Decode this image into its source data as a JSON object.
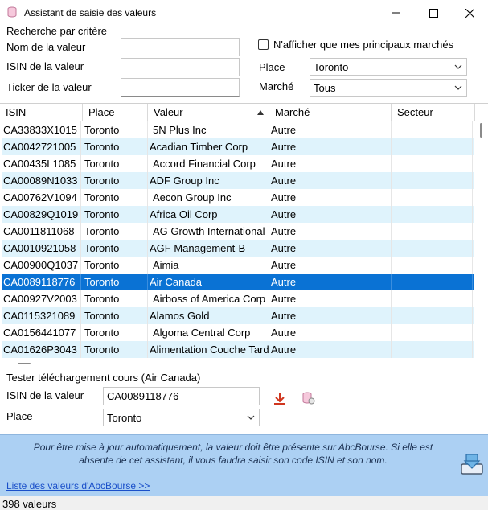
{
  "window": {
    "title": "Assistant de saisie des valeurs"
  },
  "search": {
    "group_title": "Recherche par critère",
    "name_label": "Nom de la valeur",
    "name_value": "",
    "isin_label": "ISIN de la valeur",
    "isin_value": "",
    "ticker_label": "Ticker de la valeur",
    "ticker_value": "",
    "main_markets_checkbox_label": "N'afficher que mes principaux marchés",
    "main_markets_checked": false,
    "place_label": "Place",
    "place_value": "Toronto",
    "market_label": "Marché",
    "market_value": "Tous"
  },
  "grid": {
    "columns": [
      "ISIN",
      "Place",
      "Valeur",
      "Marché",
      "Secteur"
    ],
    "sort_column": "Valeur",
    "sort_direction": "ascending",
    "selected_index": 9,
    "rows": [
      {
        "isin": "CA33833X1015",
        "place": "Toronto",
        "valeur": "5N Plus Inc",
        "marche": "Autre",
        "secteur": ""
      },
      {
        "isin": "CA0042721005",
        "place": "Toronto",
        "valeur": "Acadian Timber Corp",
        "marche": "Autre",
        "secteur": ""
      },
      {
        "isin": "CA00435L1085",
        "place": "Toronto",
        "valeur": "Accord Financial Corp",
        "marche": "Autre",
        "secteur": ""
      },
      {
        "isin": "CA00089N1033",
        "place": "Toronto",
        "valeur": "ADF Group Inc",
        "marche": "Autre",
        "secteur": ""
      },
      {
        "isin": "CA00762V1094",
        "place": "Toronto",
        "valeur": "Aecon Group Inc",
        "marche": "Autre",
        "secteur": ""
      },
      {
        "isin": "CA00829Q1019",
        "place": "Toronto",
        "valeur": "Africa Oil Corp",
        "marche": "Autre",
        "secteur": ""
      },
      {
        "isin": "CA0011811068",
        "place": "Toronto",
        "valeur": "AG Growth International",
        "marche": "Autre",
        "secteur": ""
      },
      {
        "isin": "CA0010921058",
        "place": "Toronto",
        "valeur": "AGF Management-B",
        "marche": "Autre",
        "secteur": ""
      },
      {
        "isin": "CA00900Q1037",
        "place": "Toronto",
        "valeur": "Aimia",
        "marche": "Autre",
        "secteur": ""
      },
      {
        "isin": "CA0089118776",
        "place": "Toronto",
        "valeur": "Air Canada",
        "marche": "Autre",
        "secteur": ""
      },
      {
        "isin": "CA00927V2003",
        "place": "Toronto",
        "valeur": "Airboss of America Corp",
        "marche": "Autre",
        "secteur": ""
      },
      {
        "isin": "CA0115321089",
        "place": "Toronto",
        "valeur": "Alamos Gold",
        "marche": "Autre",
        "secteur": ""
      },
      {
        "isin": "CA0156441077",
        "place": "Toronto",
        "valeur": "Algoma Central Corp",
        "marche": "Autre",
        "secteur": ""
      },
      {
        "isin": "CA01626P3043",
        "place": "Toronto",
        "valeur": "Alimentation Couche Tard",
        "marche": "Autre",
        "secteur": ""
      }
    ]
  },
  "download_test": {
    "group_title": "Tester téléchargement cours (Air Canada)",
    "isin_label": "ISIN de la valeur",
    "isin_value": "CA0089118776",
    "place_label": "Place",
    "place_value": "Toronto"
  },
  "footer": {
    "message": "Pour être mise à jour automatiquement, la valeur doit être présente sur AbcBourse. Si elle est absente de cet assistant, il vous faudra saisir son code ISIN et son nom.",
    "link_text": "Liste des valeurs d'AbcBourse >>"
  },
  "status": {
    "count_text": "398 valeurs"
  },
  "colors": {
    "selection": "#0a72d4",
    "alt_row": "#dff3fc",
    "footer_bg": "#acd0f3",
    "link": "#1a4fc9",
    "download_icon": "#d0361f"
  },
  "icons": [
    "database-icon",
    "minimize-icon",
    "maximize-icon",
    "close-icon",
    "sort-ascending-icon",
    "chevron-down-icon",
    "download-arrow-icon",
    "database-refresh-icon",
    "save-download-icon"
  ]
}
